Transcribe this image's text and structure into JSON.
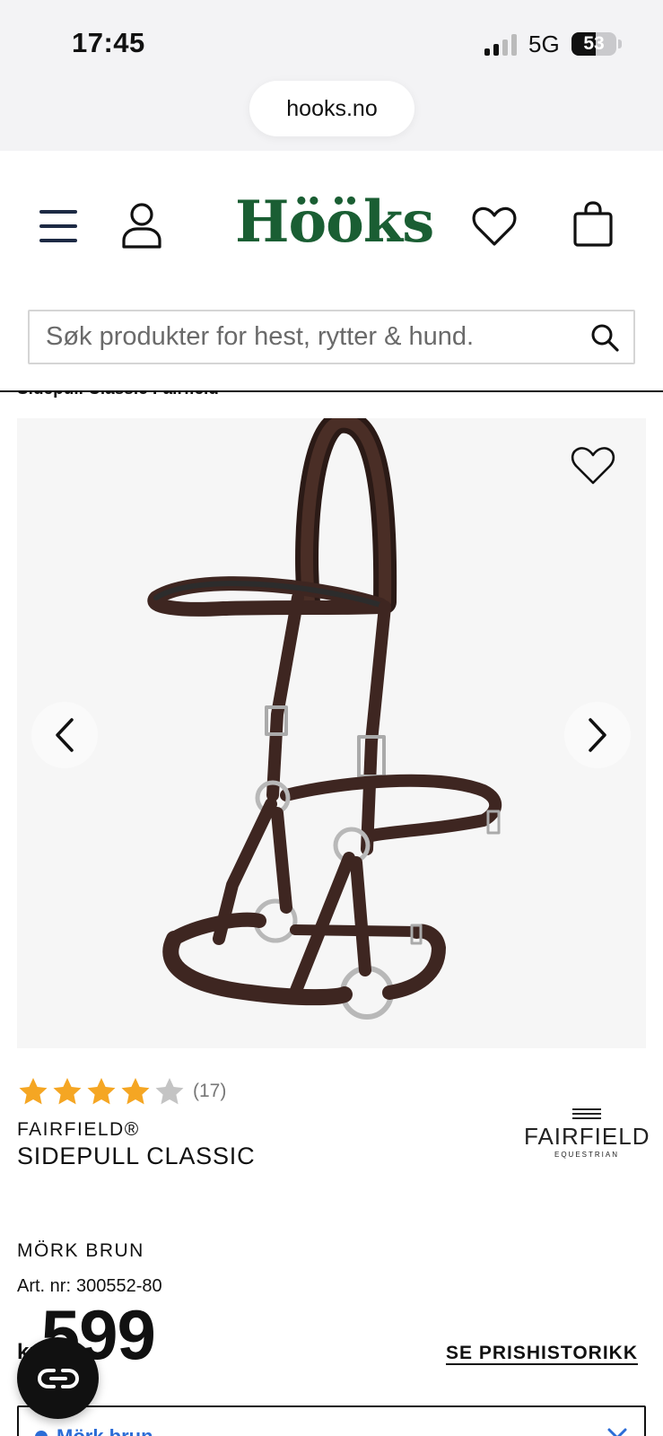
{
  "status_bar": {
    "time": "17:45",
    "network": "5G",
    "battery": "53",
    "battery_level": 0.53
  },
  "browser": {
    "url": "hooks.no"
  },
  "header": {
    "logo_text": "Hööks",
    "logo_color": "#1a5e33",
    "icons": [
      "hamburger-menu-icon",
      "user-icon",
      "heart-icon",
      "shopping-bag-icon"
    ]
  },
  "search": {
    "placeholder": "Søk produkter for hest, rytter & hund."
  },
  "breadcrumb": {
    "text": "Sidepull Classic Fairfield"
  },
  "product": {
    "rating": {
      "stars_filled": 4,
      "stars_total": 5,
      "count": "(17)",
      "star_color": "#f5a623"
    },
    "brand": "FAIRFIELD®",
    "name": "SIDEPULL CLASSIC",
    "brand_logo": {
      "word": "FAIRFIELD",
      "sub": "EQUESTRIAN"
    },
    "color_name": "MÖRK BRUN",
    "art_label": "Art. nr:",
    "art_number": "300552-80",
    "currency": "kr",
    "price": "599",
    "price_history_label": "SE PRISHISTORIKK",
    "variant_selector_text": "Mörk brun"
  },
  "colors": {
    "accent_blue": "#2b6cd6",
    "leather_brown": "#3e2621"
  }
}
